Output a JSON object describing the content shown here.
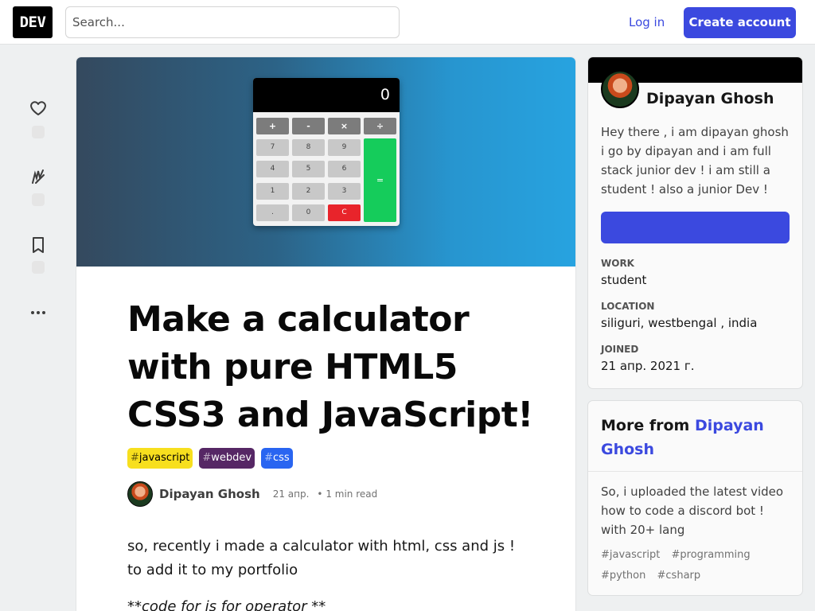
{
  "header": {
    "logo_text": "DEV",
    "search_placeholder": "Search...",
    "login_label": "Log in",
    "create_account_label": "Create account"
  },
  "calculator_cover": {
    "display": "0",
    "keys": {
      "plus": "+",
      "minus": "-",
      "multiply": "×",
      "divide": "÷",
      "k7": "7",
      "k8": "8",
      "k9": "9",
      "k4": "4",
      "k5": "5",
      "k6": "6",
      "k1": "1",
      "k2": "2",
      "k3": "3",
      "dot": ".",
      "k0": "0",
      "clear": "C",
      "equals": "="
    }
  },
  "article": {
    "title": "Make a calculator with pure HTML5 CSS3 and JavaScript!",
    "tags": [
      {
        "hash": "#",
        "name": "javascript",
        "bg": "#f7df1e",
        "fg": "#000000"
      },
      {
        "hash": "#",
        "name": "webdev",
        "bg": "#562765",
        "fg": "#ffffff"
      },
      {
        "hash": "#",
        "name": "css",
        "bg": "#2965f1",
        "fg": "#ffffff"
      }
    ],
    "author_name": "Dipayan Ghosh",
    "date": "21 апр.",
    "read_time": "• 1 min read",
    "body_paragraph": "so, recently i made a calculator with html, css and js ! to add it to my portfolio",
    "body_code_line": "**code for js for operator **"
  },
  "profile": {
    "name": "Dipayan Ghosh",
    "bio": "Hey there , i am dipayan ghosh i go by dipayan and i am full stack junior dev ! i am still a student ! also a junior Dev !",
    "work_label": "WORK",
    "work_value": "student",
    "location_label": "LOCATION",
    "location_value": "siliguri, westbengal , india",
    "joined_label": "JOINED",
    "joined_value": "21 апр. 2021 г."
  },
  "more_from": {
    "prefix": "More from",
    "author_link": "Dipayan Ghosh",
    "post_title": "So, i uploaded the latest video how to code a discord bot ! with 20+ lang",
    "post_tags": [
      "#javascript",
      "#programming",
      "#python",
      "#csharp"
    ]
  },
  "colors": {
    "accent": "#3b49df",
    "page_bg": "#eef0f1"
  }
}
